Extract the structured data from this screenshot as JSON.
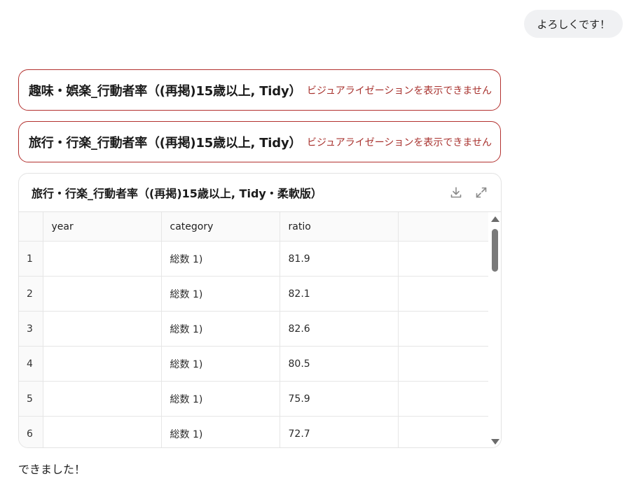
{
  "user_message": "よろしくです！",
  "error_cards": [
    {
      "title": "趣味・娯楽_行動者率（(再掲)15歳以上, Tidy）",
      "message": "ビジュアライゼーションを表示できません"
    },
    {
      "title": "旅行・行楽_行動者率（(再掲)15歳以上, Tidy）",
      "message": "ビジュアライゼーションを表示できません"
    }
  ],
  "table_card": {
    "title": "旅行・行楽_行動者率（(再掲)15歳以上, Tidy・柔軟版）",
    "download_icon": "download-icon",
    "expand_icon": "expand-icon",
    "columns": [
      "year",
      "category",
      "ratio",
      ""
    ],
    "rows": [
      {
        "idx": "1",
        "year": "",
        "category": "総数 1)",
        "ratio": "81.9"
      },
      {
        "idx": "2",
        "year": "",
        "category": "総数 1)",
        "ratio": "82.1"
      },
      {
        "idx": "3",
        "year": "",
        "category": "総数 1)",
        "ratio": "82.6"
      },
      {
        "idx": "4",
        "year": "",
        "category": "総数 1)",
        "ratio": "80.5"
      },
      {
        "idx": "5",
        "year": "",
        "category": "総数 1)",
        "ratio": "75.9"
      },
      {
        "idx": "6",
        "year": "",
        "category": "総数 1)",
        "ratio": "72.7"
      }
    ]
  },
  "assistant_footer": "できました！",
  "colors": {
    "error_border": "#b3312f",
    "error_text": "#a8322e",
    "bubble_bg": "#f0f1f3"
  }
}
